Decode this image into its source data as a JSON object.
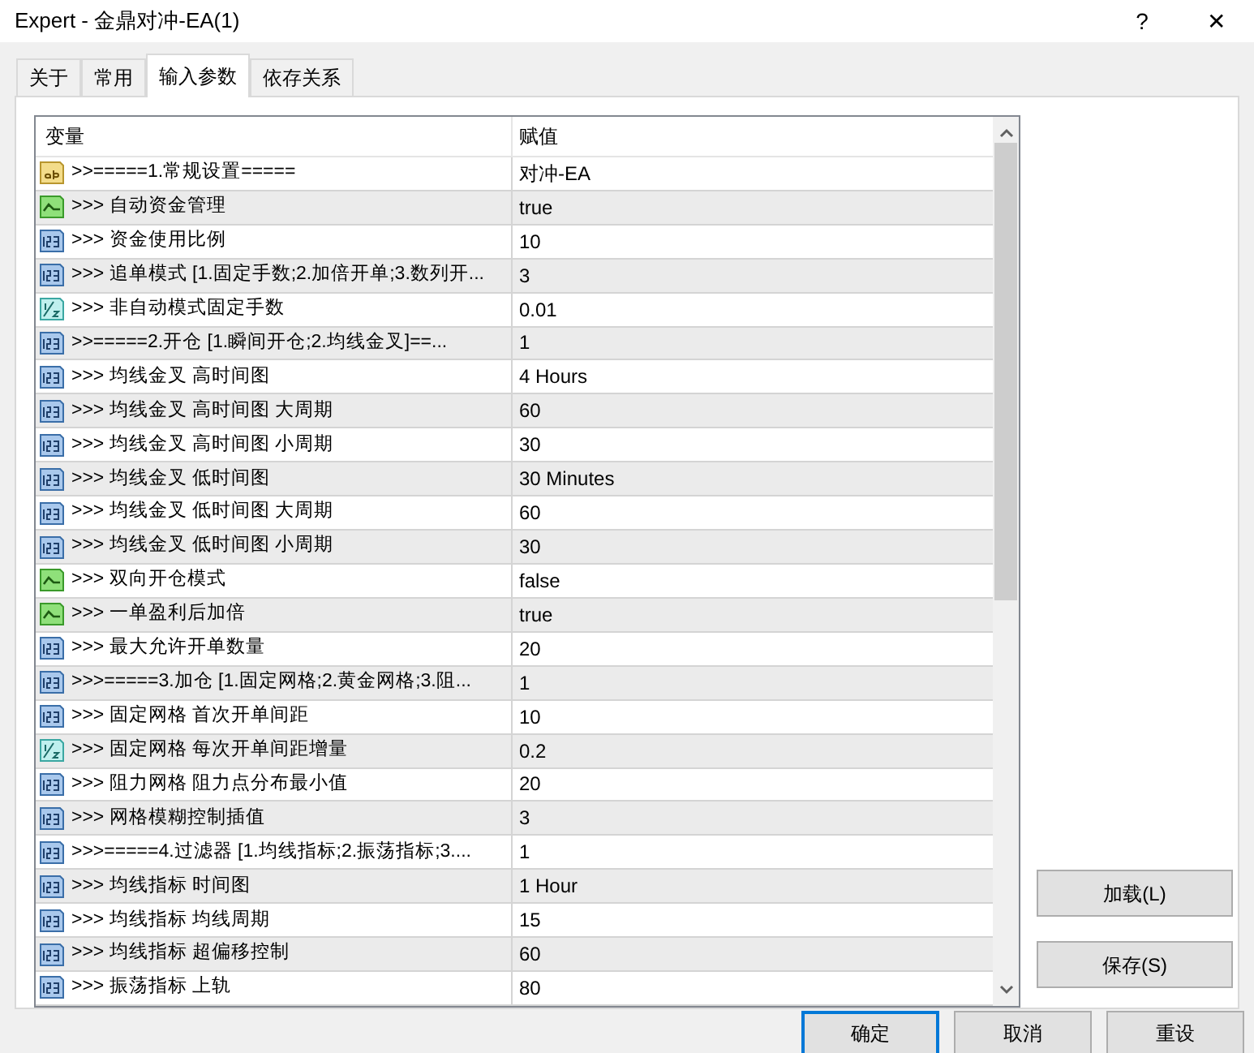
{
  "window": {
    "title": "Expert - 金鼎对冲-EA(1)",
    "help": "?",
    "close": "✕"
  },
  "tabs": [
    {
      "label": "关于",
      "selected": false
    },
    {
      "label": "常用",
      "selected": false
    },
    {
      "label": "输入参数",
      "selected": true
    },
    {
      "label": "依存关系",
      "selected": false
    }
  ],
  "table": {
    "columns": [
      "变量",
      "赋值"
    ],
    "rows": [
      {
        "kind": "string",
        "name": ">>=====1.常规设置=====",
        "value": "对冲-EA"
      },
      {
        "kind": "bool",
        "name": ">>>  自动资金管理",
        "value": "true"
      },
      {
        "kind": "int",
        "name": ">>>  资金使用比例",
        "value": "10"
      },
      {
        "kind": "int",
        "name": ">>>  追单模式 [1.固定手数;2.加倍开单;3.数列开...",
        "value": "3"
      },
      {
        "kind": "double",
        "name": ">>>  非自动模式固定手数",
        "value": "0.01"
      },
      {
        "kind": "int",
        "name": ">>=====2.开仓 [1.瞬间开仓;2.均线金叉]==...",
        "value": "1"
      },
      {
        "kind": "int",
        "name": ">>>  均线金叉 高时间图",
        "value": "4 Hours"
      },
      {
        "kind": "int",
        "name": ">>>  均线金叉 高时间图 大周期",
        "value": "60"
      },
      {
        "kind": "int",
        "name": ">>>  均线金叉 高时间图 小周期",
        "value": "30"
      },
      {
        "kind": "int",
        "name": ">>>  均线金叉 低时间图",
        "value": "30 Minutes"
      },
      {
        "kind": "int",
        "name": ">>>  均线金叉 低时间图 大周期",
        "value": "60"
      },
      {
        "kind": "int",
        "name": ">>>  均线金叉 低时间图 小周期",
        "value": "30"
      },
      {
        "kind": "bool",
        "name": ">>>  双向开仓模式",
        "value": "false"
      },
      {
        "kind": "bool",
        "name": ">>>  一单盈利后加倍",
        "value": "true"
      },
      {
        "kind": "int",
        "name": ">>>  最大允许开单数量",
        "value": "20"
      },
      {
        "kind": "int",
        "name": ">>>=====3.加仓 [1.固定网格;2.黄金网格;3.阻...",
        "value": "1"
      },
      {
        "kind": "int",
        "name": ">>>  固定网格 首次开单间距",
        "value": "10"
      },
      {
        "kind": "double",
        "name": ">>>  固定网格 每次开单间距增量",
        "value": "0.2"
      },
      {
        "kind": "int",
        "name": ">>>  阻力网格 阻力点分布最小值",
        "value": "20"
      },
      {
        "kind": "int",
        "name": ">>>  网格模糊控制插值",
        "value": "3"
      },
      {
        "kind": "int",
        "name": ">>>=====4.过滤器 [1.均线指标;2.振荡指标;3....",
        "value": "1"
      },
      {
        "kind": "int",
        "name": ">>>  均线指标 时间图",
        "value": "1 Hour"
      },
      {
        "kind": "int",
        "name": ">>>  均线指标 均线周期",
        "value": "15"
      },
      {
        "kind": "int",
        "name": ">>>  均线指标 超偏移控制",
        "value": "60"
      },
      {
        "kind": "int",
        "name": ">>>  振荡指标 上轨",
        "value": "80"
      }
    ]
  },
  "side_buttons": [
    "加载(L)",
    "保存(S)"
  ],
  "footer_buttons": [
    {
      "label": "确定",
      "selected": true
    },
    {
      "label": "取消",
      "selected": false
    },
    {
      "label": "重设",
      "selected": false
    }
  ]
}
